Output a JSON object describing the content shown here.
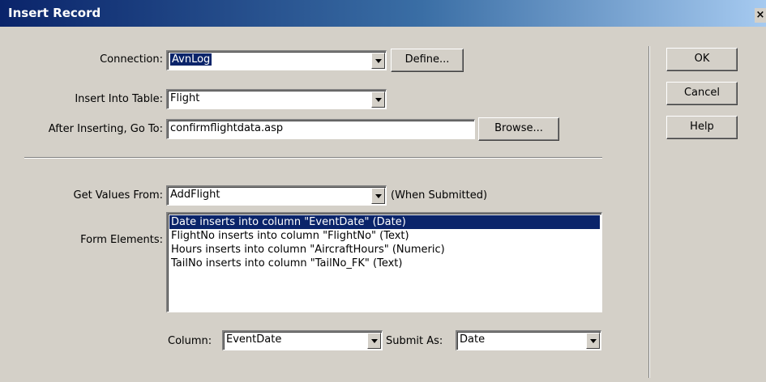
{
  "window": {
    "title": "Insert Record",
    "close_glyph": "×"
  },
  "connection": {
    "label": "Connection:",
    "value": "AvnLog",
    "define_button": "Define..."
  },
  "table": {
    "label": "Insert Into Table:",
    "value": "Flight"
  },
  "goto": {
    "label": "After Inserting, Go To:",
    "value": "confirmflightdata.asp",
    "browse_button": "Browse..."
  },
  "values_from": {
    "label": "Get Values From:",
    "value": "AddFlight",
    "note": "(When Submitted)"
  },
  "form_elements": {
    "label": "Form Elements:",
    "items": [
      "Date inserts into column \"EventDate\" (Date)",
      "FlightNo inserts into column \"FlightNo\" (Text)",
      "Hours inserts into column \"AircraftHours\" (Numeric)",
      "TailNo inserts into column \"TailNo_FK\" (Text)"
    ],
    "selected_index": 0
  },
  "column": {
    "label": "Column:",
    "value": "EventDate"
  },
  "submit_as": {
    "label": "Submit As:",
    "value": "Date"
  },
  "buttons": {
    "ok": "OK",
    "cancel": "Cancel",
    "help": "Help"
  },
  "colors": {
    "title_bar": "#0a246a",
    "selection": "#0a246a",
    "face": "#d4d0c8"
  }
}
